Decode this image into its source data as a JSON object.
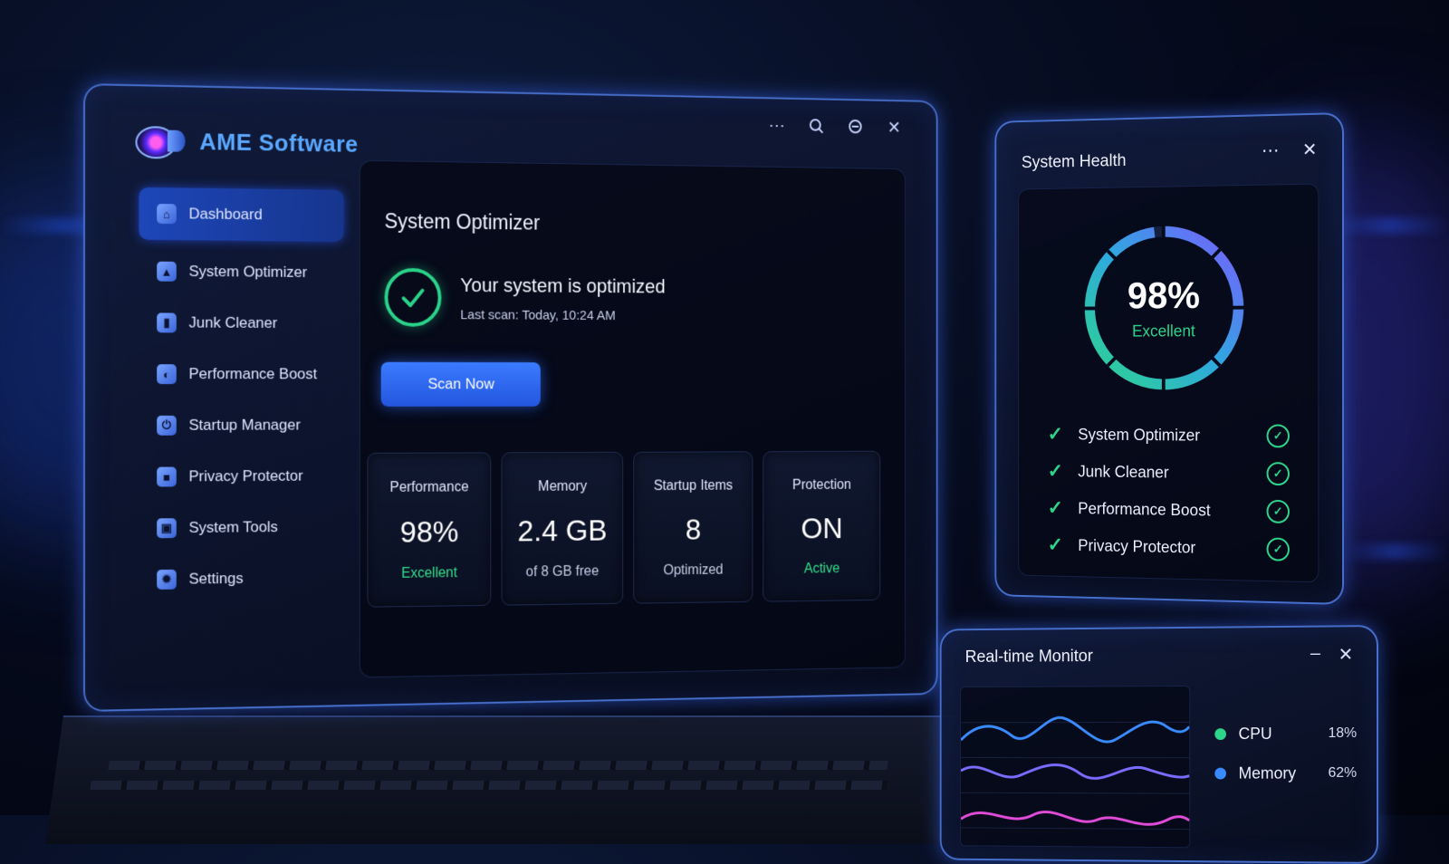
{
  "app": {
    "title": "AME Software"
  },
  "colors": {
    "accent": "#3a7bff",
    "success": "#2ed68c",
    "cpu": "#2ed68c",
    "memory": "#3a8bff",
    "disk": "#e04bd8"
  },
  "sidebar": {
    "items": [
      {
        "label": "Dashboard",
        "icon": "home-icon",
        "active": true
      },
      {
        "label": "System Optimizer",
        "icon": "rocket-icon"
      },
      {
        "label": "Junk Cleaner",
        "icon": "trash-icon"
      },
      {
        "label": "Performance Boost",
        "icon": "speedometer-icon"
      },
      {
        "label": "Startup Manager",
        "icon": "power-icon"
      },
      {
        "label": "Privacy Protector",
        "icon": "lock-icon"
      },
      {
        "label": "System Tools",
        "icon": "toolbox-icon"
      },
      {
        "label": "Settings",
        "icon": "gear-icon"
      }
    ]
  },
  "main": {
    "title": "System Optimizer",
    "status": {
      "headline": "Your system is optimized",
      "last_scan": "Last scan: Today, 10:24 AM"
    },
    "scan_button": "Scan Now",
    "stats": [
      {
        "label": "Performance",
        "value": "98%",
        "sub": "Excellent",
        "sub_highlight": true
      },
      {
        "label": "Memory",
        "value": "2.4 GB",
        "sub": "of 8 GB free",
        "sub_highlight": false
      },
      {
        "label": "Startup Items",
        "value": "8",
        "sub": "Optimized",
        "sub_highlight": false
      },
      {
        "label": "Protection",
        "value": "ON",
        "sub": "Active",
        "sub_highlight": true
      }
    ]
  },
  "health": {
    "title": "System Health",
    "score": "98%",
    "score_fraction": 0.98,
    "rating": "Excellent",
    "items": [
      "System Optimizer",
      "Junk Cleaner",
      "Performance Boost",
      "Privacy Protector"
    ]
  },
  "monitor": {
    "title": "Real-time Monitor",
    "legend": [
      {
        "name": "CPU",
        "value": "18%"
      },
      {
        "name": "Memory",
        "value": "62%"
      }
    ]
  }
}
